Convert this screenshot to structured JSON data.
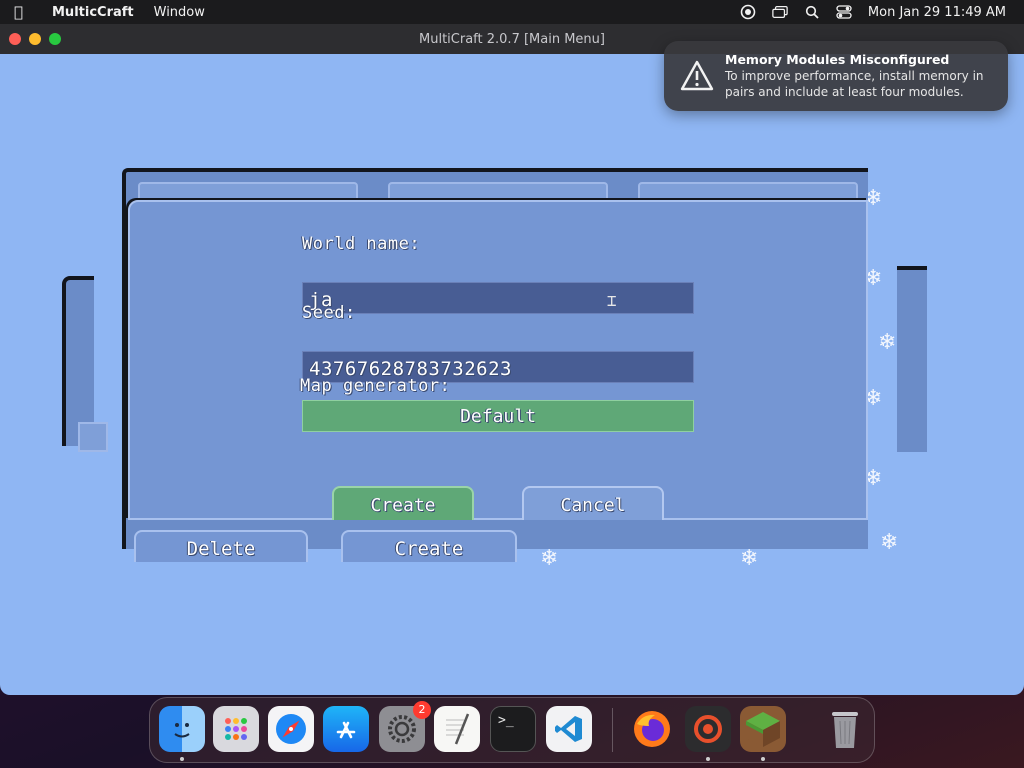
{
  "menubar": {
    "app_name": "MulticCraft",
    "items": [
      "Window"
    ],
    "datetime": "Mon Jan 29  11:49 AM"
  },
  "window": {
    "title": "MultiCraft 2.0.7 [Main Menu]"
  },
  "notification": {
    "title": "Memory Modules Misconfigured",
    "body": "To improve performance, install memory in pairs and include at least four modules."
  },
  "dialog": {
    "world_name_label": "World name:",
    "world_name_value": "ja_",
    "seed_label": "Seed:",
    "seed_value": "43767628783732623",
    "mapgen_label": "Map generator:",
    "mapgen_value": "Default",
    "create_label": "Create",
    "cancel_label": "Cancel"
  },
  "bottom": {
    "delete_label": "Delete",
    "create_label": "Create"
  },
  "dock": {
    "items": [
      "finder",
      "launchpad",
      "safari",
      "app-store",
      "system-settings",
      "textedit",
      "terminal",
      "vscode",
      "firefox",
      "screen-recorder",
      "multicraft",
      "trash"
    ],
    "settings_badge": "2"
  },
  "colors": {
    "sky": "#8fb6f3",
    "panel": "#7596d3",
    "field": "#485d94",
    "green_button": "#5fa877"
  }
}
